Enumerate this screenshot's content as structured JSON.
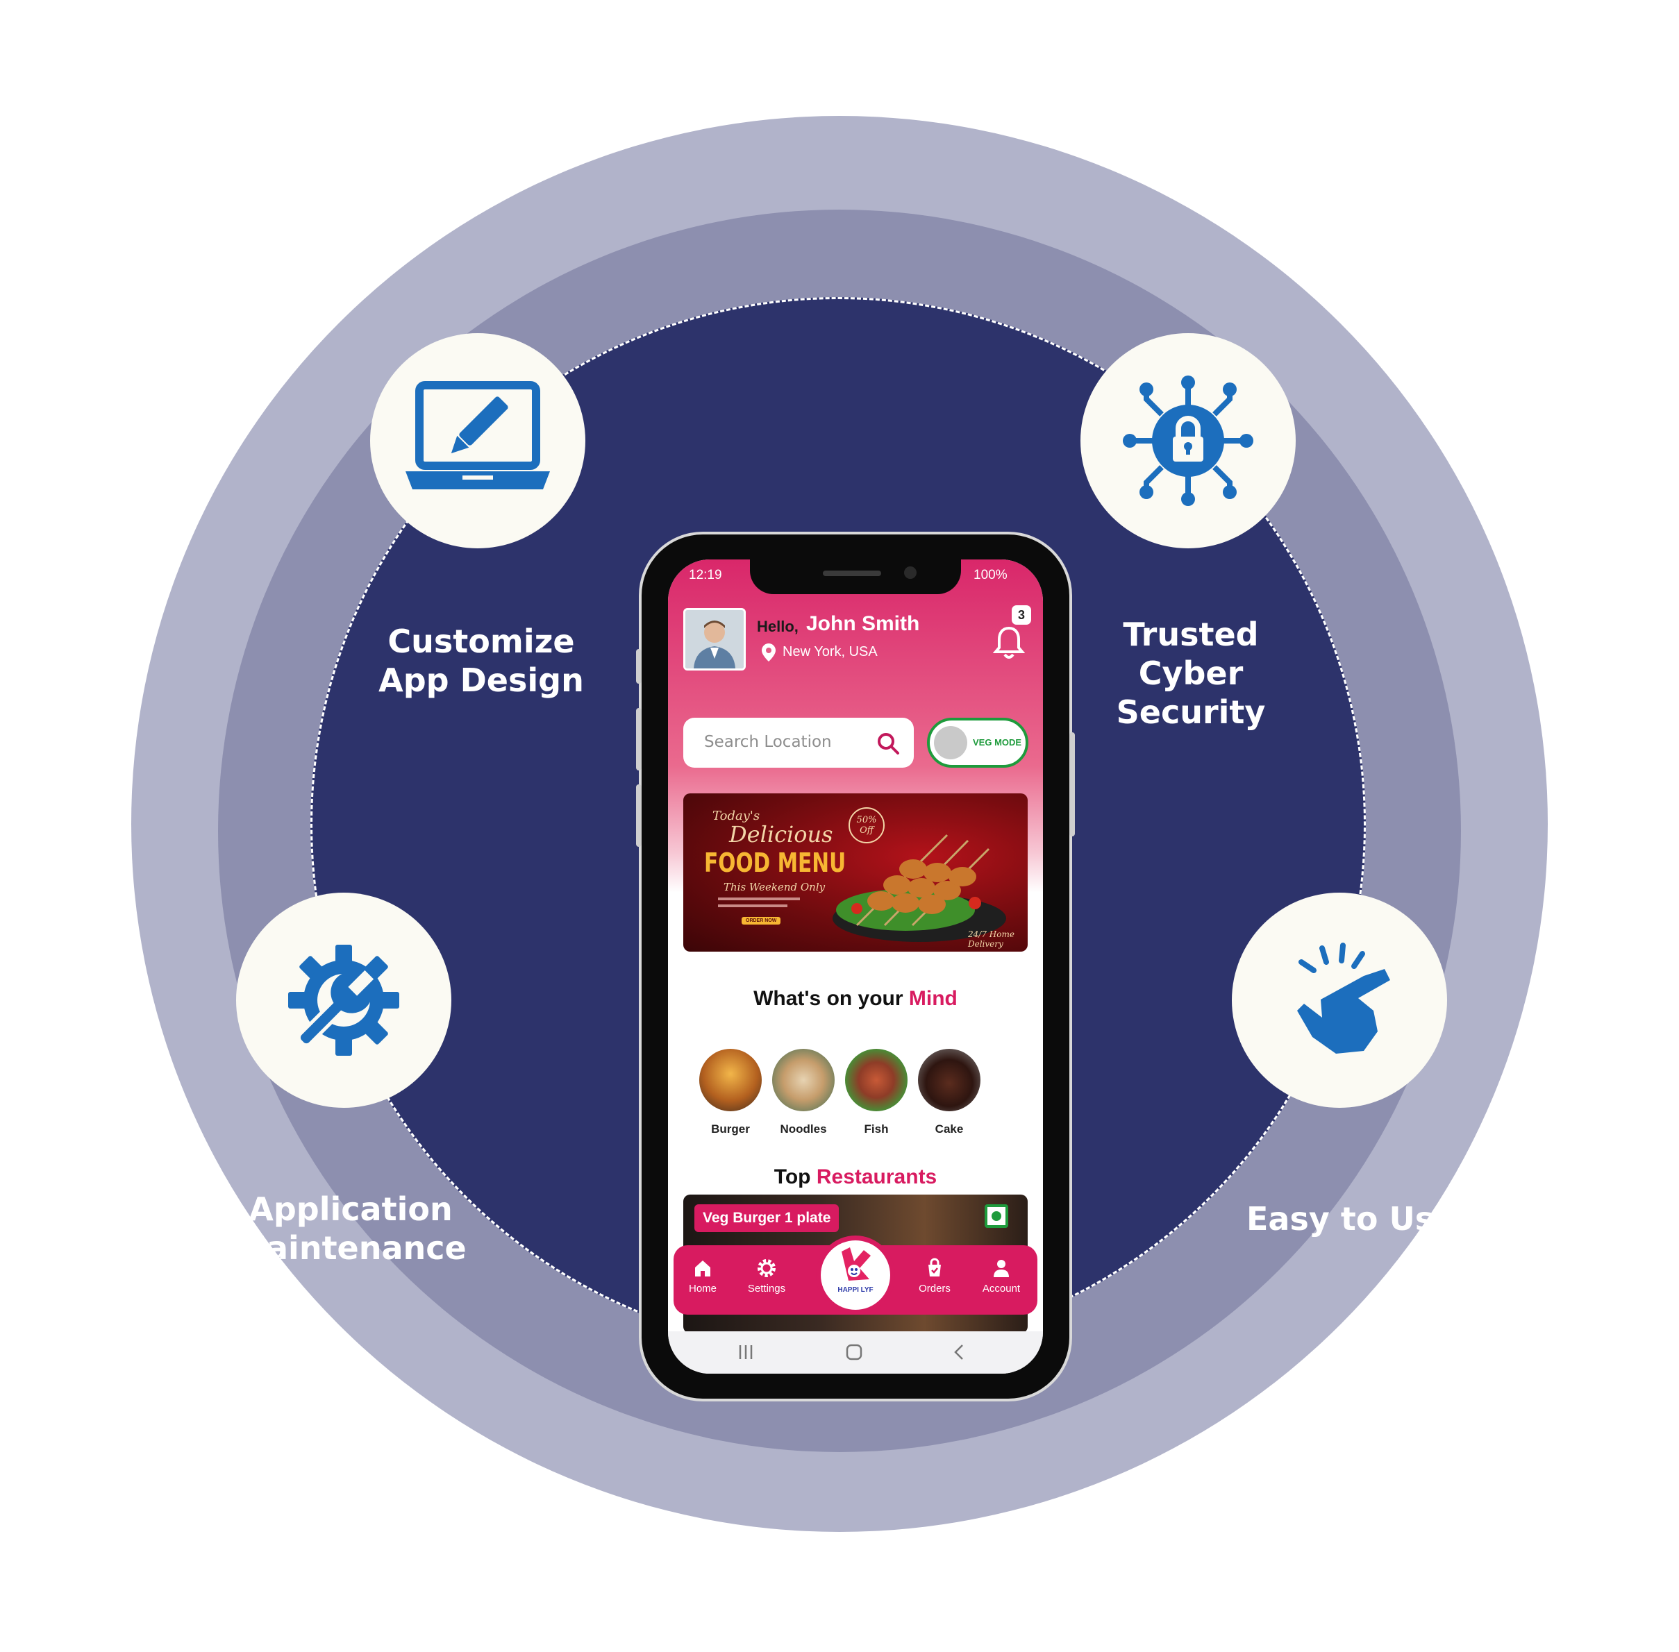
{
  "features": [
    {
      "id": "customize",
      "label": "Customize\nApp Design",
      "icon": "laptop-edit-icon"
    },
    {
      "id": "security",
      "label": "Trusted\nCyber\nSecurity",
      "icon": "lock-network-icon"
    },
    {
      "id": "maintenance",
      "label": "Application\nMaintenance",
      "icon": "gear-wrench-icon"
    },
    {
      "id": "easy",
      "label": "Easy to Use",
      "icon": "tap-hand-icon"
    }
  ],
  "colors": {
    "ring_outer": "#b1b3ca",
    "ring_mid": "#8d8faf",
    "ring_inner": "#2d336b",
    "icon_blue": "#1c6ebd",
    "brand_pink": "#d81b60",
    "veg_green": "#1e9b3c"
  },
  "app": {
    "status_time": "12:19",
    "status_battery": "100%",
    "greeting": "Hello,",
    "user_name": "John Smith",
    "location": "New York, USA",
    "notification_count": "3",
    "search_placeholder": "Search Location",
    "veg_mode_label": "VEG MODE",
    "banner": {
      "line1": "Today's",
      "line2": "Delicious",
      "line3": "FOOD MENU",
      "line4": "This Weekend Only",
      "badge": "50% Off",
      "cta": "ORDER NOW",
      "footer": "24/7 Home Delivery"
    },
    "mind_section": {
      "prefix": "What's on your",
      "accent": "Mind"
    },
    "categories": [
      "Burger",
      "Noodles",
      "Fish",
      "Cake"
    ],
    "restaurants_section": {
      "prefix": "Top",
      "accent": "Restaurants"
    },
    "restaurant_card_tag": "Veg Burger 1 plate",
    "nav": {
      "home": "Home",
      "settings": "Settings",
      "orders": "Orders",
      "account": "Account",
      "logo": "HAPPI LYF"
    }
  }
}
